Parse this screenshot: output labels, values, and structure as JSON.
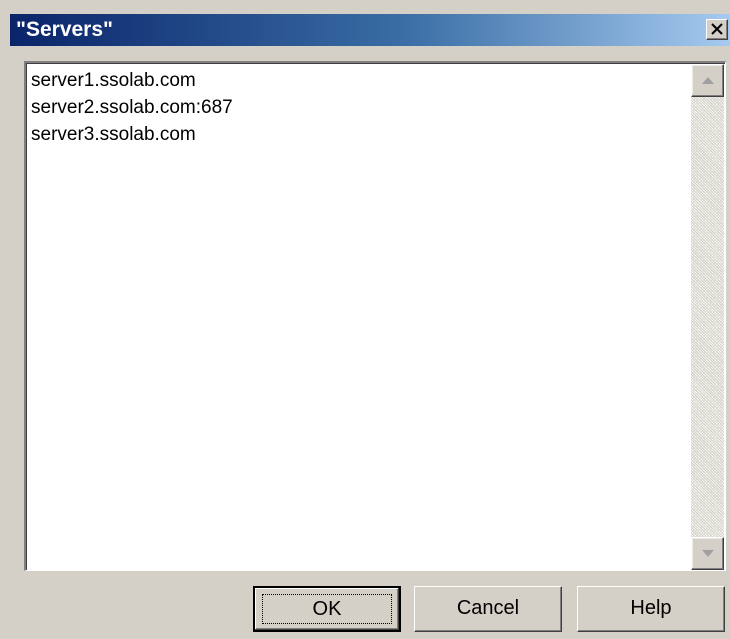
{
  "window": {
    "title": "\"Servers\"",
    "close_icon": "close-icon"
  },
  "servers": {
    "items": [
      "server1.ssolab.com",
      "server2.ssolab.com:687",
      "server3.ssolab.com"
    ]
  },
  "scrollbar": {
    "up_icon": "arrow-up-icon",
    "down_icon": "arrow-down-icon"
  },
  "buttons": {
    "ok_label": "OK",
    "cancel_label": "Cancel",
    "help_label": "Help"
  },
  "colors": {
    "titlebar_start": "#0a246a",
    "titlebar_end": "#a6caf0",
    "dialog_face": "#d4d0c8"
  }
}
